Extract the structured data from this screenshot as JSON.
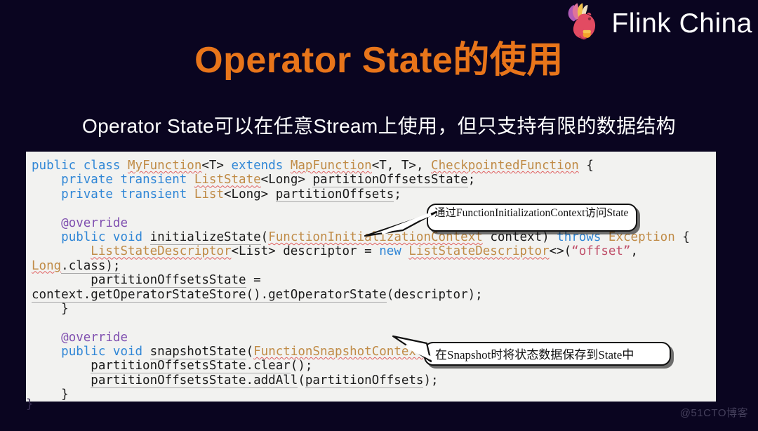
{
  "slide": {
    "background_color": "#0a0520",
    "title": "Operator State的使用",
    "title_color": "#e8751a",
    "subtitle": "Operator State可以在任意Stream上使用，但只支持有限的数据结构",
    "subtitle_color": "#ffffff"
  },
  "logo": {
    "brand_text": "Flink China",
    "icon_name": "flink-squirrel-logo"
  },
  "code_panel": {
    "background_color": "#f2f2f0",
    "language": "java",
    "lines": [
      "public class MyFunction<T> extends MapFunction<T, T>, CheckpointedFunction {",
      "    private transient ListState<Long> partitionOffsetsState;",
      "    private transient List<Long> partitionOffsets;",
      "",
      "    @override",
      "    public void initializeState(FunctionInitializationContext context) throws Exception {",
      "        ListStateDescriptor<List> descriptor = new ListStateDescriptor<>(“offset”,",
      "Long.class);",
      "        partitionOffsetsState =",
      "context.getOperatorStateStore().getOperatorState(descriptor);",
      "    }",
      "",
      "    @override",
      "    public void snapshotState(FunctionSnapshotContext context) throws Exception {",
      "        partitionOffsetsState.clear();",
      "        partitionOffsetsState.addAll(partitionOffsets);",
      "    }",
      "}"
    ],
    "token_colors": {
      "keyword": "#2f86d6",
      "type": "#c08b46",
      "annotation": "#8050b0",
      "string": "#c0506a",
      "plain": "#1b1b1b"
    }
  },
  "callouts": [
    {
      "id": "callout-1",
      "text": "通过FunctionInitializationContext访问State",
      "points_to": "initializeState-signature"
    },
    {
      "id": "callout-2",
      "text": "在Snapshot时将状态数据保存到State中",
      "points_to": "snapshotState-signature"
    }
  ],
  "watermark": {
    "text": "@51CTO博客"
  }
}
